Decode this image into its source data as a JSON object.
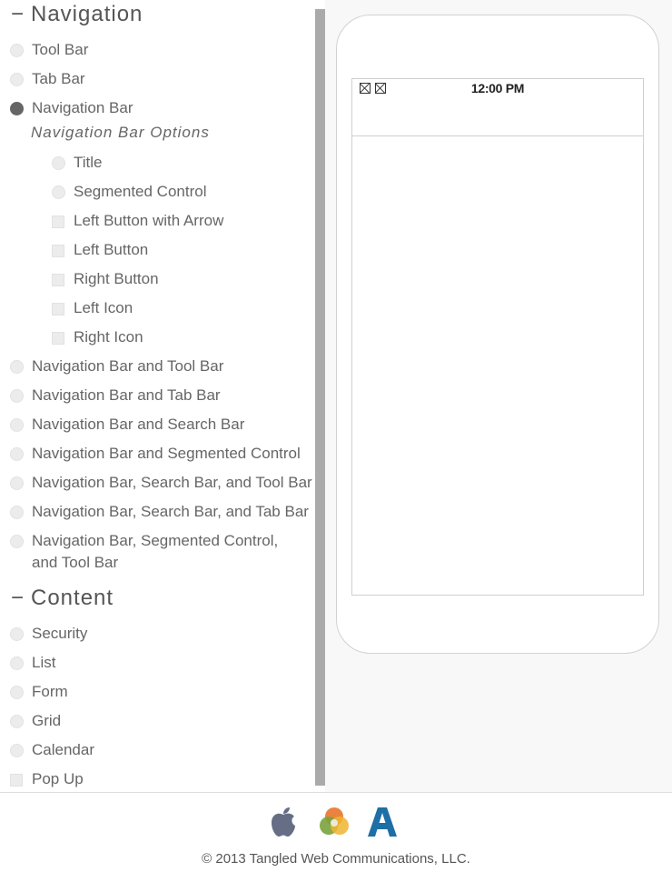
{
  "sidebar": {
    "navigation": {
      "header": "Navigation",
      "collapse_symbol": "−",
      "items": [
        {
          "label": "Tool Bar",
          "control": "radio",
          "selected": false
        },
        {
          "label": "Tab Bar",
          "control": "radio",
          "selected": false
        },
        {
          "label": "Navigation Bar",
          "control": "radio",
          "selected": true
        }
      ],
      "options_title": "Navigation Bar Options",
      "options": [
        {
          "label": "Title",
          "control": "radio"
        },
        {
          "label": "Segmented Control",
          "control": "radio"
        },
        {
          "label": "Left Button with Arrow",
          "control": "checkbox"
        },
        {
          "label": "Left Button",
          "control": "checkbox"
        },
        {
          "label": "Right Button",
          "control": "checkbox"
        },
        {
          "label": "Left Icon",
          "control": "checkbox"
        },
        {
          "label": "Right Icon",
          "control": "checkbox"
        }
      ],
      "more_items": [
        {
          "label": "Navigation Bar and Tool Bar",
          "control": "radio"
        },
        {
          "label": "Navigation Bar and Tab Bar",
          "control": "radio"
        },
        {
          "label": "Navigation Bar and Search Bar",
          "control": "radio"
        },
        {
          "label": "Navigation Bar and Segmented Control",
          "control": "radio"
        },
        {
          "label": "Navigation Bar, Search Bar, and Tool Bar",
          "control": "radio"
        },
        {
          "label": "Navigation Bar, Search Bar, and Tab Bar",
          "control": "radio"
        },
        {
          "label": "Navigation Bar, Segmented Control, and Tool Bar",
          "control": "radio"
        }
      ]
    },
    "content": {
      "header": "Content",
      "collapse_symbol": "−",
      "items": [
        {
          "label": "Security",
          "control": "radio"
        },
        {
          "label": "List",
          "control": "radio"
        },
        {
          "label": "Form",
          "control": "radio"
        },
        {
          "label": "Grid",
          "control": "radio"
        },
        {
          "label": "Calendar",
          "control": "radio"
        },
        {
          "label": "Pop Up",
          "control": "checkbox"
        }
      ]
    }
  },
  "preview": {
    "status_time": "12:00 PM",
    "status_icons": [
      "broken-image-icon",
      "broken-image-icon"
    ]
  },
  "footer": {
    "logos": [
      "apple-logo-icon",
      "android-logo-icon",
      "appstore-a-logo-icon"
    ],
    "copyright": "© 2013 Tangled Web Communications, LLC."
  }
}
